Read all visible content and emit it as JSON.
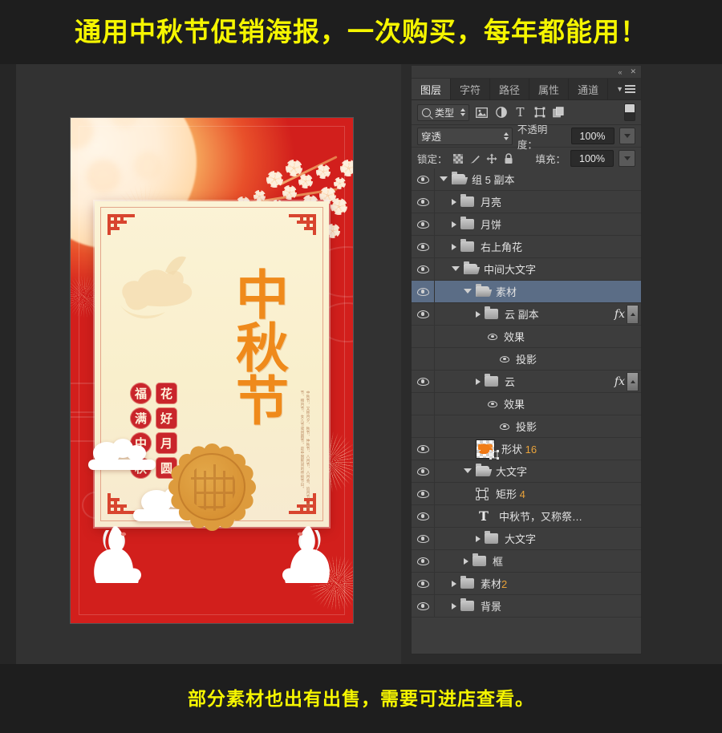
{
  "banners": {
    "top": "通用中秋节促销海报，一次购买，每年都能用！",
    "bottom": "部分素材也出有出售，需要可进店查看。"
  },
  "poster": {
    "title": "中秋节",
    "seal_column_right": [
      "花",
      "好",
      "月",
      "圆"
    ],
    "seal_column_left": [
      "福",
      "满",
      "中",
      "秋"
    ],
    "body_text": "中秋节，又称月夕、秋节、仲秋节、八月节、八月会、追月节、玩月节、拜月节、女儿节或团圆节，是中国民间的传统节日。",
    "colors": {
      "background_red": "#d21f1c",
      "card_cream": "#f9efcc",
      "title_orange": "#ef8a1b",
      "seal_red": "#c9252b",
      "mooncake_gold": "#dd9b3d"
    },
    "elements": [
      "moon",
      "firework-burst",
      "plum-blossom-branch",
      "clouds",
      "mooncake",
      "rabbit-left",
      "rabbit-right"
    ]
  },
  "panel": {
    "window_controls": {
      "collapse": "«",
      "close": "✕"
    },
    "tabs": [
      {
        "label": "图层",
        "active": true
      },
      {
        "label": "字符",
        "active": false
      },
      {
        "label": "路径",
        "active": false
      },
      {
        "label": "属性",
        "active": false
      },
      {
        "label": "通道",
        "active": false
      }
    ],
    "filter": {
      "select_value": "类型",
      "icons": [
        "image-filter-icon",
        "adjustment-filter-icon",
        "type-filter-icon",
        "shape-filter-icon",
        "smart-object-filter-icon"
      ],
      "toggle": "filter-enable-toggle"
    },
    "blend": {
      "mode": "穿透",
      "opacity_label": "不透明度：",
      "opacity_value": "100%"
    },
    "lock": {
      "label": "锁定：",
      "icons": [
        "transparency-lock-icon",
        "image-lock-icon",
        "position-lock-icon",
        "all-lock-icon"
      ],
      "fill_label": "填充：",
      "fill_value": "100%"
    },
    "layers": [
      {
        "name": "组 5 副本",
        "num": "",
        "indent": 0,
        "type": "group",
        "expanded": true,
        "visible": true,
        "selected": false,
        "fx": false
      },
      {
        "name": "月亮",
        "num": "",
        "indent": 1,
        "type": "group",
        "expanded": false,
        "visible": true,
        "selected": false,
        "fx": false
      },
      {
        "name": "月饼",
        "num": "",
        "indent": 1,
        "type": "group",
        "expanded": false,
        "visible": true,
        "selected": false,
        "fx": false
      },
      {
        "name": "右上角花",
        "num": "",
        "indent": 1,
        "type": "group",
        "expanded": false,
        "visible": true,
        "selected": false,
        "fx": false
      },
      {
        "name": "中间大文字",
        "num": "",
        "indent": 1,
        "type": "group",
        "expanded": true,
        "visible": true,
        "selected": false,
        "fx": false
      },
      {
        "name": "素材",
        "num": "",
        "indent": 2,
        "type": "group",
        "expanded": true,
        "visible": true,
        "selected": true,
        "fx": false
      },
      {
        "name": "云 副本",
        "num": "",
        "indent": 3,
        "type": "group",
        "expanded": false,
        "visible": true,
        "selected": false,
        "fx": true
      },
      {
        "name": "效果",
        "num": "",
        "indent": 4,
        "type": "effects",
        "visible": true,
        "selected": false,
        "fx": false
      },
      {
        "name": "投影",
        "num": "",
        "indent": 5,
        "type": "effect",
        "visible": true,
        "selected": false,
        "fx": false
      },
      {
        "name": "云",
        "num": "",
        "indent": 3,
        "type": "group",
        "expanded": false,
        "visible": true,
        "selected": false,
        "fx": true
      },
      {
        "name": "效果",
        "num": "",
        "indent": 4,
        "type": "effects",
        "visible": true,
        "selected": false,
        "fx": false
      },
      {
        "name": "投影",
        "num": "",
        "indent": 5,
        "type": "effect",
        "visible": true,
        "selected": false,
        "fx": false
      },
      {
        "name": "形状 ",
        "num": "16",
        "indent": 3,
        "type": "shape-thumb",
        "visible": true,
        "selected": false,
        "fx": false
      },
      {
        "name": "大文字",
        "num": "",
        "indent": 2,
        "type": "group",
        "expanded": true,
        "visible": true,
        "selected": false,
        "fx": false
      },
      {
        "name": "矩形 ",
        "num": "4",
        "indent": 3,
        "type": "vector",
        "visible": true,
        "selected": false,
        "fx": false
      },
      {
        "name": "中秋节，又称祭…",
        "num": "",
        "indent": 3,
        "type": "text",
        "visible": true,
        "selected": false,
        "fx": false
      },
      {
        "name": "大文字",
        "num": "",
        "indent": 3,
        "type": "group",
        "expanded": false,
        "visible": true,
        "selected": false,
        "fx": false
      },
      {
        "name": "框",
        "num": "",
        "indent": 2,
        "type": "group",
        "expanded": false,
        "visible": true,
        "selected": false,
        "fx": false
      },
      {
        "name": "素材",
        "num": "2",
        "indent": 1,
        "type": "group",
        "expanded": false,
        "visible": true,
        "selected": false,
        "fx": false
      },
      {
        "name": "背景",
        "num": "",
        "indent": 1,
        "type": "group",
        "expanded": false,
        "visible": true,
        "selected": false,
        "fx": false
      }
    ]
  }
}
